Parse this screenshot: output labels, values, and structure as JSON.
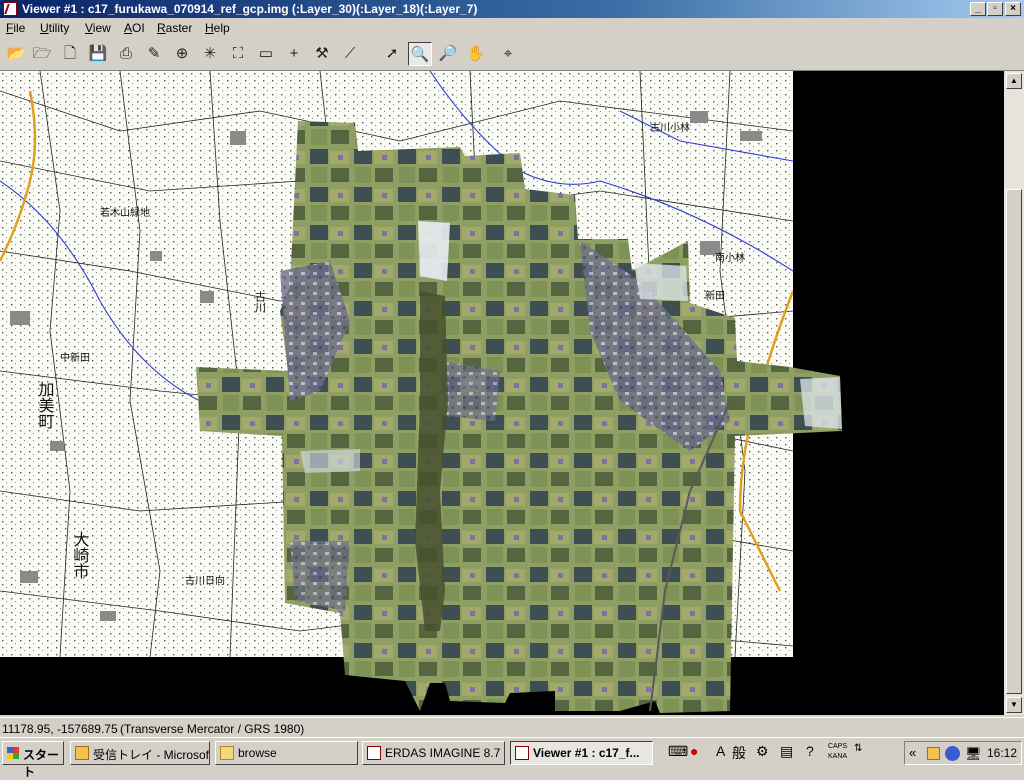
{
  "window": {
    "title": "Viewer #1 : c17_furukawa_070914_ref_gcp.img (:Layer_30)(:Layer_18)(:Layer_7)",
    "controls": [
      "_",
      "▫",
      "×"
    ]
  },
  "menu": {
    "items": [
      "File",
      "Utility",
      "View",
      "AOI",
      "Raster",
      "Help"
    ]
  },
  "toolbar": {
    "tools": [
      {
        "name": "open-icon",
        "glyph": "📂"
      },
      {
        "name": "open-layer-icon",
        "glyph": "🗁"
      },
      {
        "name": "new-icon",
        "glyph": "🗋"
      },
      {
        "name": "save-icon",
        "glyph": "💾"
      },
      {
        "name": "print-icon",
        "glyph": "⎙"
      },
      {
        "name": "erase-icon",
        "glyph": "✎"
      },
      {
        "name": "info-icon",
        "glyph": "⊕"
      },
      {
        "name": "fit-to-frame-icon",
        "glyph": "✳"
      },
      {
        "name": "zoom-extent-icon",
        "glyph": "⛶"
      },
      {
        "name": "measure-icon",
        "glyph": "▭"
      },
      {
        "name": "cursor-crosshair-icon",
        "glyph": "+"
      },
      {
        "name": "tools-icon",
        "glyph": "⚒"
      },
      {
        "name": "profile-icon",
        "glyph": "⟋"
      },
      {
        "name": "select-arrow-icon",
        "glyph": "➚"
      },
      {
        "name": "zoom-in-icon",
        "glyph": "🔍"
      },
      {
        "name": "zoom-out-icon",
        "glyph": "🔎"
      },
      {
        "name": "pan-hand-icon",
        "glyph": "✋"
      },
      {
        "name": "inquire-icon",
        "glyph": "⌖"
      }
    ],
    "active_tool": "zoom-in-icon"
  },
  "map": {
    "labels": [
      "若木山緑地",
      "加美町",
      "大崎市",
      "古川",
      "古川日向",
      "南小林",
      "中新田",
      "新田",
      "古川小林"
    ]
  },
  "status": {
    "coords": "11178.95, -157689.75",
    "projection": "(Transverse Mercator / GRS 1980)"
  },
  "taskbar": {
    "start_label": "スタート",
    "tasks": [
      {
        "label": "受信トレイ - Microsoft ...",
        "icon": "outlook-icon",
        "active": false
      },
      {
        "label": "browse",
        "icon": "folder-icon",
        "active": false
      },
      {
        "label": "ERDAS IMAGINE 8.7",
        "icon": "erdas-icon",
        "active": false
      },
      {
        "label": "Viewer #1 : c17_f...",
        "icon": "viewer-icon",
        "active": true
      }
    ],
    "ime": [
      "A",
      "般"
    ],
    "caps": "CAPS",
    "kana": "KANA",
    "clock": "16:12"
  }
}
